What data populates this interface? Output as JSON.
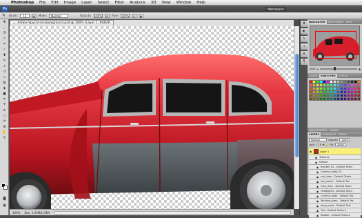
{
  "menubar": {
    "items": [
      "Photoshop",
      "File",
      "Edit",
      "Image",
      "Layer",
      "Select",
      "Filter",
      "Analysis",
      "3D",
      "View",
      "Window",
      "Help"
    ]
  },
  "appbar": {
    "logo": "Ps",
    "workspace": "Workspace"
  },
  "options": {
    "brush_label": "Brush:",
    "brush_size": "13",
    "mode_label": "Mode:",
    "mode_value": "Normal",
    "opacity_label": "Opacity:",
    "opacity_value": "100%",
    "flow_label": "Flow:",
    "flow_value": "100%"
  },
  "document": {
    "tab_title": "Adobe-Spycar-no-background.psd @ 100% (Layer 1, RGB/8)",
    "zoom": "100%",
    "doc_size": "Doc: 1.03M/1.03M"
  },
  "panels": {
    "nav_tabs": [
      "NAVIGATOR",
      "HISTOGRAM",
      "INFO"
    ],
    "nav_zoom": "100%",
    "swatch_tabs": [
      "COLOR",
      "SWATCHES",
      "STYLES"
    ],
    "adjust_tabs": [
      "ADJUSTMENTS",
      "MASKS"
    ],
    "layer_tabs": [
      "LAYERS",
      "CHANNELS",
      "PATHS"
    ],
    "blend_mode": "Normal",
    "opacity_label": "Opacity:",
    "opacity_value": "100%",
    "lock_label": "Lock:",
    "fill_label": "Fill:",
    "fill_value": "100%",
    "layers": [
      {
        "label": "Layer 1",
        "kind": "sel"
      },
      {
        "label": "Textures",
        "kind": "fx"
      },
      {
        "label": "Diffuse",
        "kind": "fx"
      },
      {
        "label": "bracket_02 - Default Textu",
        "kind": "sub"
      },
      {
        "label": "Chrome_plate_02",
        "kind": "sub"
      },
      {
        "label": "roof_door - Default Textur",
        "kind": "sub"
      },
      {
        "label": "tail_plastic - Default Tex",
        "kind": "sub"
      },
      {
        "label": "Grey_floor - Default Textu",
        "kind": "sub"
      },
      {
        "label": "Headlight1 - Default Textu",
        "kind": "sub"
      },
      {
        "label": "Chrome_plate - Default Tex",
        "kind": "sub"
      },
      {
        "label": "Window_glass - Default Tex",
        "kind": "sub"
      },
      {
        "label": "body_paint - Default Text",
        "kind": "sub"
      },
      {
        "label": "Tire - Default Texture",
        "kind": "sub"
      },
      {
        "label": "Rubber - Default Texture",
        "kind": "sub"
      }
    ]
  },
  "colors": {
    "car_red": "#d81f2c",
    "car_body_dark": "#9e1219",
    "glass": "#1a1a1a",
    "steel": "#5b6166",
    "fg": "#000000",
    "bg": "#ffffff"
  },
  "icons": [
    "apple-icon",
    "brush-icon",
    "move-tool-icon",
    "marquee-tool-icon",
    "lasso-tool-icon",
    "crop-tool-icon",
    "eye-icon",
    "zoom-icon"
  ]
}
